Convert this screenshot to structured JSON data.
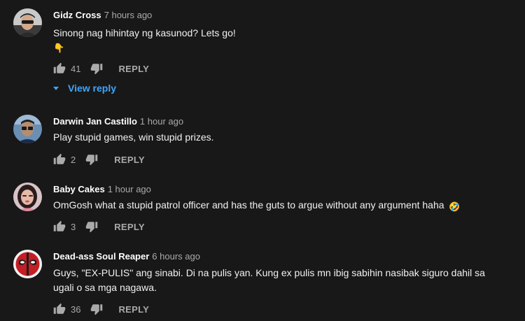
{
  "colors": {
    "background": "#181818",
    "text": "#f1f1f1",
    "muted": "#aaaaaa",
    "link": "#3ea6ff"
  },
  "comments": [
    {
      "author": "Gidz Cross",
      "time": "7 hours ago",
      "text": "Sinong nag hihintay ng kasunod? Lets go!",
      "emoji": "👇",
      "likes": "41",
      "reply_label": "REPLY",
      "view_reply_label": "View reply",
      "avatar_icon": "avatar-man-sunglasses-icon"
    },
    {
      "author": "Darwin Jan Castillo",
      "time": "1 hour ago",
      "text": "Play stupid games, win stupid prizes.",
      "likes": "2",
      "reply_label": "REPLY",
      "avatar_icon": "avatar-man-glasses-icon"
    },
    {
      "author": "Baby Cakes",
      "time": "1 hour ago",
      "text": "OmGosh what a stupid patrol officer and has the guts to argue without any argument haha",
      "emoji": "🤣",
      "likes": "3",
      "reply_label": "REPLY",
      "avatar_icon": "avatar-woman-icon"
    },
    {
      "author": "Dead-ass Soul Reaper",
      "time": "6 hours ago",
      "text": "Guys, \"EX-PULIS\" ang sinabi. Di na pulis yan. Kung ex pulis mn ibig sabihin nasibak siguro dahil sa ugali o sa mga nagawa.",
      "likes": "36",
      "reply_label": "REPLY",
      "avatar_icon": "avatar-deadpool-icon"
    }
  ]
}
